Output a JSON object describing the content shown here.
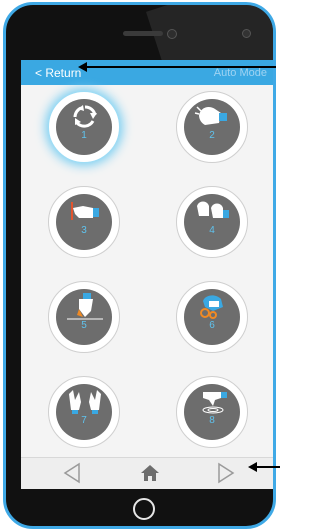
{
  "header": {
    "return_label": "< Return",
    "mode_label": "Auto Mode"
  },
  "gestures": [
    {
      "number": "1",
      "icon": "refresh-arrows-icon",
      "selected": true
    },
    {
      "number": "2",
      "icon": "wave-hand-icon",
      "selected": false
    },
    {
      "number": "3",
      "icon": "pointing-hand-icon",
      "selected": false
    },
    {
      "number": "4",
      "icon": "two-hands-icon",
      "selected": false
    },
    {
      "number": "5",
      "icon": "hand-down-icon",
      "selected": false
    },
    {
      "number": "6",
      "icon": "hand-ring-icon",
      "selected": false
    },
    {
      "number": "7",
      "icon": "open-hands-icon",
      "selected": false
    },
    {
      "number": "8",
      "icon": "hand-ripple-icon",
      "selected": false
    }
  ],
  "nav": {
    "back_icon": "triangle-left-icon",
    "home_icon": "home-icon",
    "forward_icon": "triangle-right-icon"
  },
  "colors": {
    "accent": "#3aa8e2",
    "tile_inner": "#6d6d6d",
    "label": "#5fc3ee",
    "glove_cuff": "#3aa8e2"
  }
}
